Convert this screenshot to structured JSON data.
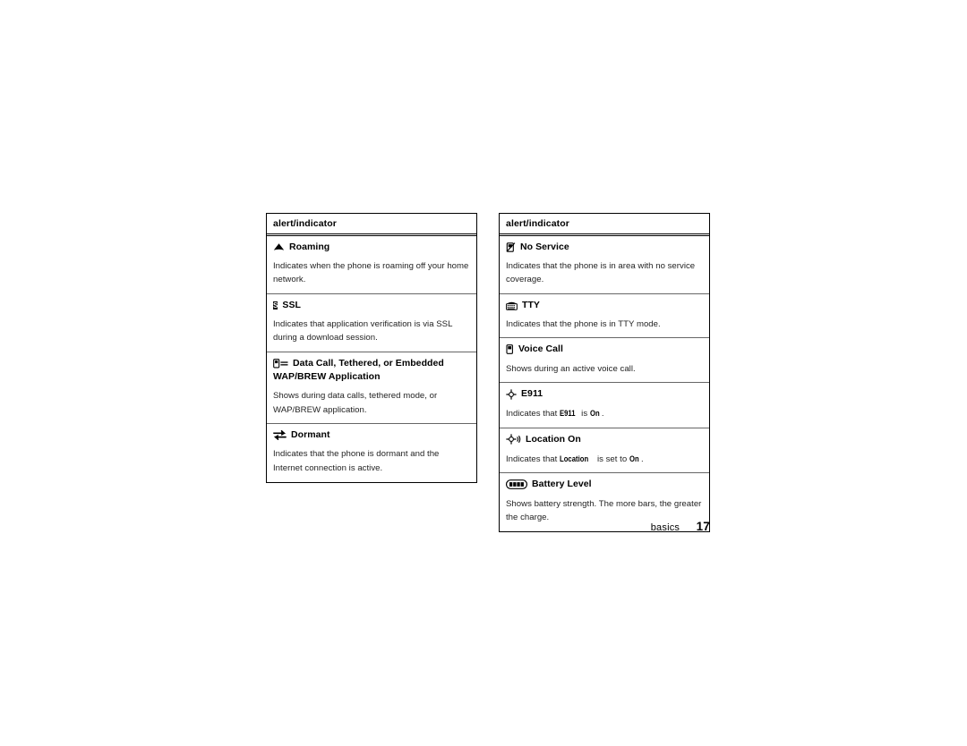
{
  "page": {
    "footer_label": "basics",
    "page_number": "17"
  },
  "tables": [
    {
      "id": "left",
      "header": "alert/indicator",
      "rows": [
        {
          "icon": "roaming-triangle-icon",
          "title": "Roaming",
          "desc_parts": [
            {
              "text": "Indicates when the phone is roaming off your home network.",
              "style": "normal"
            }
          ]
        },
        {
          "icon": "ssl-icon",
          "title": "SSL",
          "desc_parts": [
            {
              "text": "Indicates that application verification is via SSL during a download session.",
              "style": "normal"
            }
          ]
        },
        {
          "icon": "data-call-icon",
          "title": "Data Call, Tethered, or Embedded WAP/BREW Application",
          "desc_parts": [
            {
              "text": "Shows during data calls, tethered mode, or WAP/BREW application.",
              "style": "normal"
            }
          ]
        },
        {
          "icon": "dormant-exchange-icon",
          "title": "Dormant",
          "desc_parts": [
            {
              "text": "Indicates that the phone is dormant and the Internet connection is active.",
              "style": "normal"
            }
          ]
        }
      ]
    },
    {
      "id": "right",
      "header": "alert/indicator",
      "rows": [
        {
          "icon": "no-service-icon",
          "title": "No Service",
          "desc_parts": [
            {
              "text": "Indicates that the phone is in area with no service coverage.",
              "style": "normal"
            }
          ]
        },
        {
          "icon": "tty-icon",
          "title": "TTY",
          "desc_parts": [
            {
              "text": "Indicates that the phone is in TTY mode.",
              "style": "normal"
            }
          ]
        },
        {
          "icon": "voice-call-icon",
          "title": "Voice Call",
          "desc_parts": [
            {
              "text": "Shows during an active voice call.",
              "style": "normal"
            }
          ]
        },
        {
          "icon": "e911-crosshair-icon",
          "title": "E911",
          "desc_parts": [
            {
              "text": "Indicates that ",
              "style": "normal"
            },
            {
              "text": "E911",
              "style": "term"
            },
            {
              "text": " is ",
              "style": "normal"
            },
            {
              "text": "On",
              "style": "term"
            },
            {
              "text": ".",
              "style": "normal"
            }
          ]
        },
        {
          "icon": "location-on-icon",
          "title": "Location On",
          "desc_parts": [
            {
              "text": "Indicates that ",
              "style": "normal"
            },
            {
              "text": "Location",
              "style": "term"
            },
            {
              "text": " is set to ",
              "style": "normal"
            },
            {
              "text": "On",
              "style": "term"
            },
            {
              "text": ".",
              "style": "normal"
            }
          ]
        },
        {
          "icon": "battery-level-icon",
          "title": "Battery Level",
          "desc_parts": [
            {
              "text": "Shows battery strength. The more bars, the greater the charge.",
              "style": "normal"
            }
          ]
        }
      ]
    }
  ]
}
